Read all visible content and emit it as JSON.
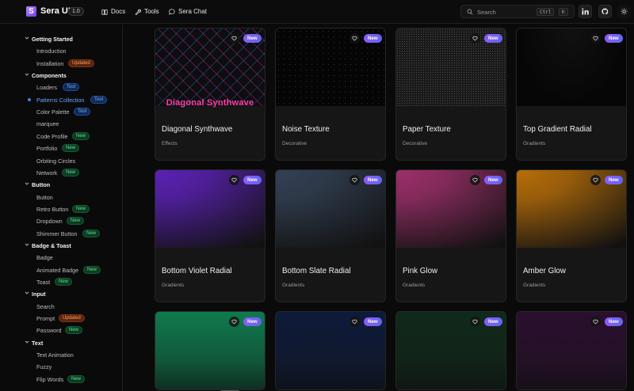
{
  "header": {
    "brand": "Sera UI",
    "version": "1.0",
    "nav": [
      {
        "label": "Docs",
        "icon": "book-icon"
      },
      {
        "label": "Tools",
        "icon": "wrench-icon"
      },
      {
        "label": "Sera Chat",
        "icon": "chat-icon"
      }
    ],
    "search": {
      "placeholder": "Search",
      "key1": "Ctrl",
      "key2": "K"
    },
    "buttons": [
      "linkedin-icon",
      "github-icon",
      "theme-toggle-icon"
    ]
  },
  "sidebar": {
    "sections": [
      {
        "label": "Getting Started",
        "items": [
          {
            "label": "Introduction"
          },
          {
            "label": "Installation",
            "badge": "Updated",
            "badge_type": "upd"
          }
        ]
      },
      {
        "label": "Components",
        "items": [
          {
            "label": "Loaders",
            "badge": "Tool",
            "badge_type": "tool"
          },
          {
            "label": "Patterns Collection",
            "badge": "Tool",
            "badge_type": "tool",
            "active": true
          },
          {
            "label": "Color Palette",
            "badge": "Tool",
            "badge_type": "tool"
          },
          {
            "label": "marquee"
          },
          {
            "label": "Code Profile",
            "badge": "New",
            "badge_type": "new"
          },
          {
            "label": "Portfolio",
            "badge": "New",
            "badge_type": "new"
          },
          {
            "label": "Orbiting Circles"
          },
          {
            "label": "Network",
            "badge": "New",
            "badge_type": "new"
          }
        ]
      },
      {
        "label": "Button",
        "items": [
          {
            "label": "Button"
          },
          {
            "label": "Retro Button",
            "badge": "New",
            "badge_type": "new"
          },
          {
            "label": "Dropdown",
            "badge": "New",
            "badge_type": "new"
          },
          {
            "label": "Shimmer Button",
            "badge": "New",
            "badge_type": "new"
          }
        ]
      },
      {
        "label": "Badge & Toast",
        "items": [
          {
            "label": "Badge"
          },
          {
            "label": "Animated Badge",
            "badge": "New",
            "badge_type": "new"
          },
          {
            "label": "Toast",
            "badge": "New",
            "badge_type": "new"
          }
        ]
      },
      {
        "label": "Input",
        "items": [
          {
            "label": "Search"
          },
          {
            "label": "Prompt",
            "badge": "Updated",
            "badge_type": "upd"
          },
          {
            "label": "Password",
            "badge": "New",
            "badge_type": "new"
          }
        ]
      },
      {
        "label": "Text",
        "items": [
          {
            "label": "Text Animation"
          },
          {
            "label": "Fuzzy"
          },
          {
            "label": "Flip Words",
            "badge": "New",
            "badge_type": "new"
          }
        ]
      }
    ]
  },
  "cards": [
    {
      "title": "Diagonal Synthwave",
      "category": "Effects",
      "badge": "New",
      "preview_text": "Diagonal Synthwave",
      "style": "synthwave"
    },
    {
      "title": "Noise Texture",
      "category": "Decorative",
      "badge": "New",
      "style": "noise"
    },
    {
      "title": "Paper Texture",
      "category": "Decorative",
      "badge": "New",
      "style": "paper"
    },
    {
      "title": "Top Gradient Radial",
      "category": "Gradients",
      "badge": "New",
      "style": "topradial"
    },
    {
      "title": "Bottom Violet Radial",
      "category": "Gradients",
      "badge": "New",
      "style": "violet",
      "color": "#5b21b6"
    },
    {
      "title": "Bottom Slate Radial",
      "category": "Gradients",
      "badge": "New",
      "style": "slate",
      "color": "#334155"
    },
    {
      "title": "Pink Glow",
      "category": "Gradients",
      "badge": "New",
      "style": "pink",
      "color": "#9d2f6a"
    },
    {
      "title": "Amber Glow",
      "category": "Gradients",
      "badge": "New",
      "style": "amber",
      "color": "#b86e08"
    },
    {
      "badge": "New",
      "style": "emerald",
      "color": "#0f7a4d"
    },
    {
      "badge": "New",
      "style": "navy",
      "color": "#0d1a3a"
    },
    {
      "badge": "New",
      "style": "darkgreen",
      "color": "#0f2a1a"
    },
    {
      "badge": "New",
      "style": "plum",
      "color": "#2a0f2e"
    }
  ]
}
